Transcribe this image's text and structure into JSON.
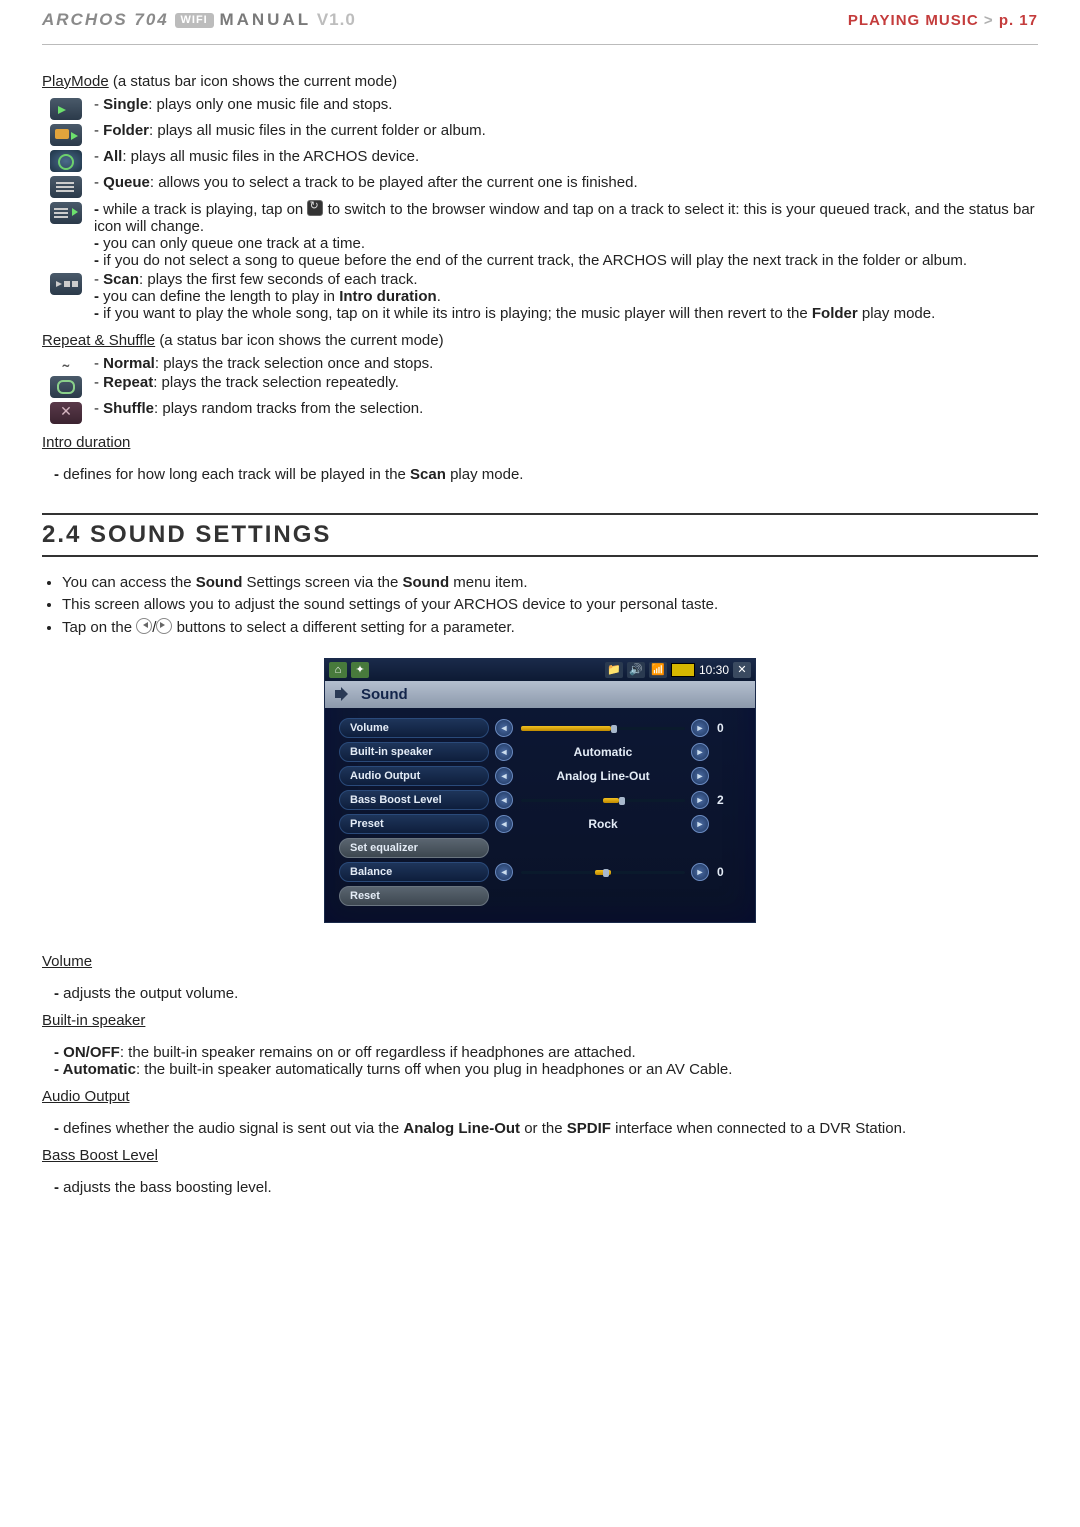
{
  "header": {
    "brand": "ARCHOS 704",
    "wifi": "WIFI",
    "manual": "MANUAL",
    "ver": "V1.0",
    "section": "PLAYING MUSIC",
    "arrow": ">",
    "page": "p. 17"
  },
  "playmode": {
    "title": "PlayMode",
    "note": "(a status bar icon shows the current mode)",
    "items": {
      "single": {
        "name": "Single",
        "desc": ": plays only one music file and stops."
      },
      "folder": {
        "name": "Folder",
        "desc": ": plays all music files in the current folder or album."
      },
      "all": {
        "name": "All",
        "desc": ": plays all music files in the ARCHOS device."
      },
      "queue": {
        "name": "Queue",
        "desc": ": allows you to select a track to be played after the current one is finished.",
        "sub1a": "while a track is playing, tap on ",
        "sub1b": " to switch to the browser window and tap on a track to select it: this is your queued track, and the status bar icon will change.",
        "sub2": "you can only queue one track at a time.",
        "sub3": "if you do not select a song to queue before the end of the current track, the ARCHOS will play the next track in the folder or album."
      },
      "scan": {
        "name": "Scan",
        "desc": ": plays the first few seconds of each track.",
        "sub1a": "you can define the length to play in ",
        "sub1b": "Intro duration",
        "sub1c": ".",
        "sub2a": "if you want to play the whole song, tap on it while its intro is playing; the music player will then revert to the ",
        "sub2b": "Folder",
        "sub2c": " play mode."
      }
    }
  },
  "repeat": {
    "title": "Repeat & Shuffle",
    "note": "(a status bar icon shows the current mode)",
    "normal": {
      "name": "Normal",
      "desc": ": plays the track selection once and stops."
    },
    "rep": {
      "name": "Repeat",
      "desc": ": plays the track selection repeatedly."
    },
    "shuf": {
      "name": "Shuffle",
      "desc": ": plays random tracks from the selection."
    }
  },
  "intro": {
    "title": "Intro duration",
    "body_a": "defines for how long each track will be played in the ",
    "body_b": "Scan",
    "body_c": " play mode."
  },
  "sound_heading": "2.4  Sound Settings",
  "sound_intro": {
    "b1a": "You can access the ",
    "b1b": "Sound",
    "b1c": " Settings screen via the ",
    "b1d": "Sound",
    "b1e": " menu item.",
    "b2": "This screen allows you to adjust the sound settings of your ARCHOS device to your personal taste.",
    "b3a": "Tap on the ",
    "b3b": " buttons to select a different setting for a parameter."
  },
  "device": {
    "clock": "10:30",
    "title": "Sound",
    "rows": {
      "volume": {
        "label": "Volume",
        "value": "0",
        "fill": 55,
        "thumb": 55
      },
      "speaker": {
        "label": "Built-in speaker",
        "value": "Automatic"
      },
      "output": {
        "label": "Audio Output",
        "value": "Analog Line-Out"
      },
      "bass": {
        "label": "Bass Boost Level",
        "value": "2",
        "fill": 60,
        "thumb": 60,
        "offset": 50
      },
      "preset": {
        "label": "Preset",
        "value": "Rock"
      },
      "seteq": {
        "label": "Set equalizer"
      },
      "balance": {
        "label": "Balance",
        "value": "0",
        "fill": 50,
        "thumb": 50
      },
      "reset": {
        "label": "Reset"
      }
    }
  },
  "defs": {
    "volume": {
      "title": "Volume",
      "body": "adjusts the output volume."
    },
    "speaker": {
      "title": "Built-in speaker",
      "on": {
        "name": "ON/OFF",
        "desc": ": the built-in speaker remains on or off regardless if headphones are attached."
      },
      "auto": {
        "name": "Automatic",
        "desc": ": the built-in speaker automatically turns off when you plug in headphones or an AV Cable."
      }
    },
    "output": {
      "title": "Audio Output",
      "a": "defines whether the audio signal is sent out via the ",
      "b": "Analog Line-Out",
      "c": " or the ",
      "d": "SPDIF",
      "e": " interface when connected to a DVR Station."
    },
    "bass": {
      "title": "Bass Boost Level",
      "body": "adjusts the bass boosting level."
    }
  }
}
